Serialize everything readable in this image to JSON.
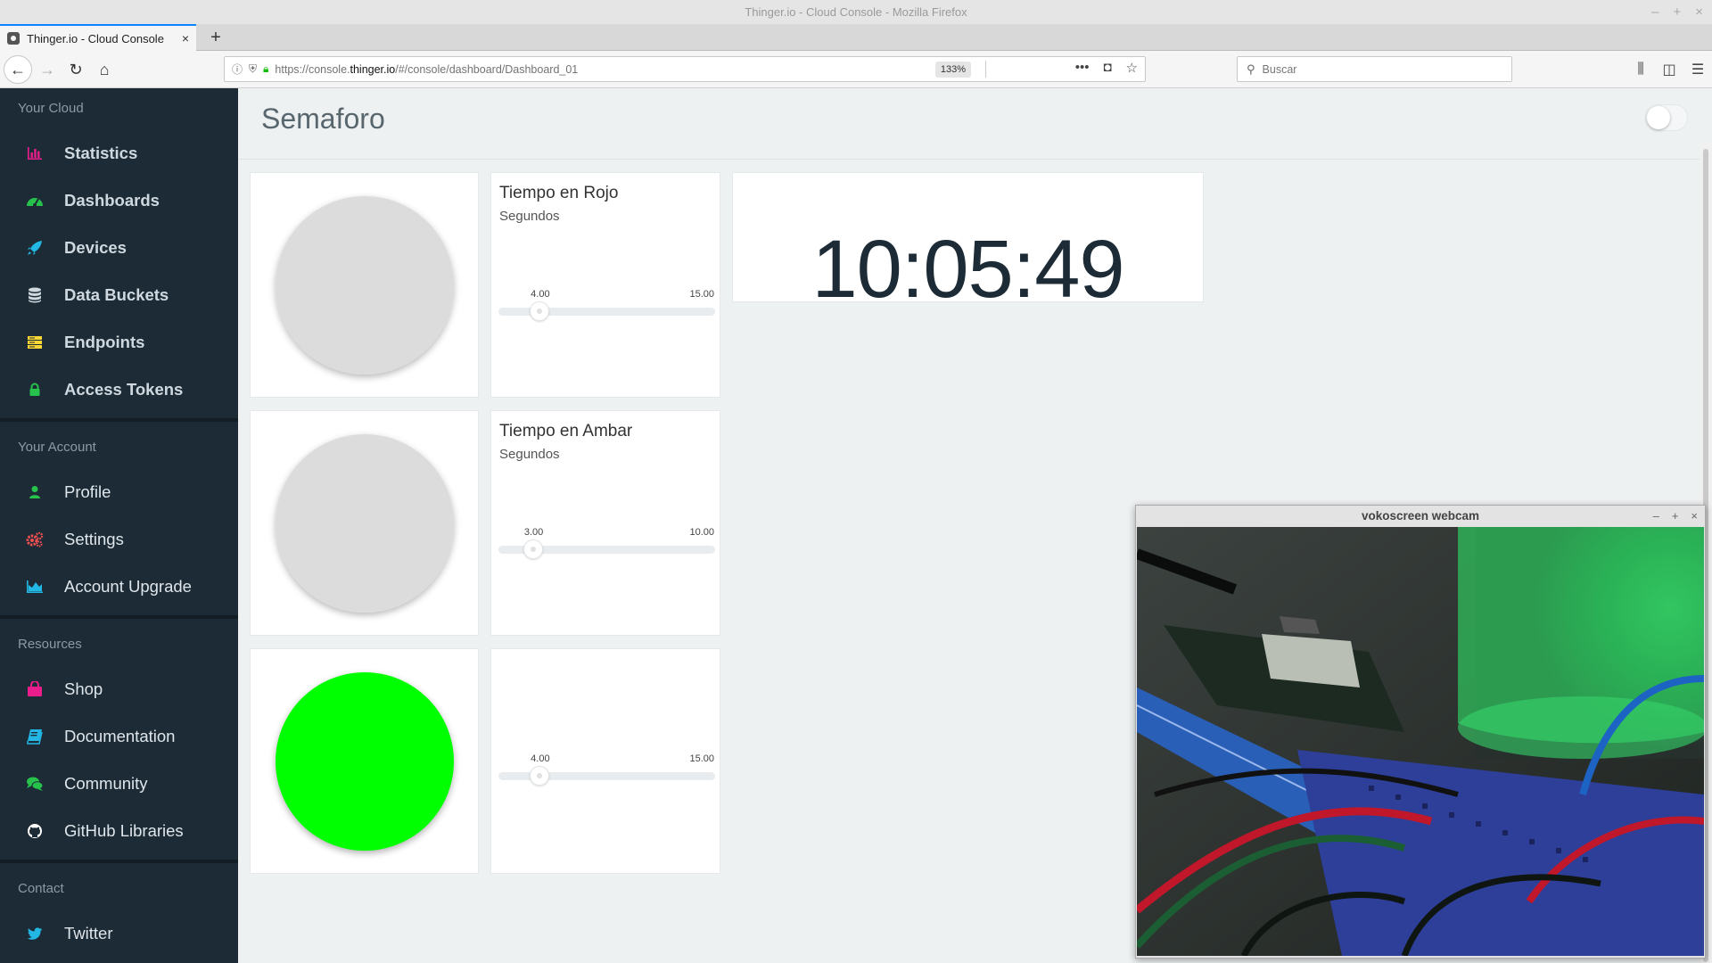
{
  "window": {
    "title": "Thinger.io - Cloud Console - Mozilla Firefox",
    "controls": [
      "–",
      "+",
      "×"
    ]
  },
  "tabs": [
    {
      "title": "Thinger.io - Cloud Console",
      "close": "×"
    }
  ],
  "new_tab": "+",
  "navbar": {
    "back": "←",
    "forward": "→",
    "reload": "↻",
    "home": "⌂",
    "url_prefix": "https://console.",
    "url_host": "thinger.io",
    "url_path": "/#/console/dashboard/Dashboard_01",
    "zoom": "133%",
    "page_actions": [
      "•••",
      "◘",
      "☆"
    ],
    "search_placeholder": "Buscar",
    "tool_icons": [
      "library-icon",
      "sidebar-toggle-icon",
      "menu-icon"
    ]
  },
  "sidebar": {
    "sections": [
      {
        "title": "Your Cloud",
        "items": [
          {
            "label": "Statistics",
            "icon": "bar-chart-icon",
            "color": "#e91e8c"
          },
          {
            "label": "Dashboards",
            "icon": "dashboard-icon",
            "color": "#27c24c"
          },
          {
            "label": "Devices",
            "icon": "rocket-icon",
            "color": "#23b7e5"
          },
          {
            "label": "Data Buckets",
            "icon": "database-icon",
            "color": "#cfd8df"
          },
          {
            "label": "Endpoints",
            "icon": "server-icon",
            "color": "#fad733"
          },
          {
            "label": "Access Tokens",
            "icon": "lock-icon",
            "color": "#27c24c"
          }
        ]
      },
      {
        "title": "Your Account",
        "items": [
          {
            "label": "Profile",
            "icon": "user-icon",
            "color": "#27c24c"
          },
          {
            "label": "Settings",
            "icon": "cogs-icon",
            "color": "#f05050"
          },
          {
            "label": "Account Upgrade",
            "icon": "area-chart-icon",
            "color": "#23b7e5"
          }
        ]
      },
      {
        "title": "Resources",
        "items": [
          {
            "label": "Shop",
            "icon": "shopping-bag-icon",
            "color": "#e91e8c"
          },
          {
            "label": "Documentation",
            "icon": "book-icon",
            "color": "#23b7e5"
          },
          {
            "label": "Community",
            "icon": "comments-icon",
            "color": "#27c24c"
          },
          {
            "label": "GitHub Libraries",
            "icon": "github-icon",
            "color": "#ffffff"
          }
        ]
      },
      {
        "title": "Contact",
        "items": [
          {
            "label": "Twitter",
            "icon": "twitter-icon",
            "color": "#23b7e5"
          }
        ]
      }
    ]
  },
  "dashboard": {
    "title": "Semaforo",
    "edit_mode": false,
    "leds": [
      {
        "state": "off",
        "color": "#dcdcdc"
      },
      {
        "state": "off",
        "color": "#dcdcdc"
      },
      {
        "state": "on",
        "color": "#00ff00"
      }
    ],
    "sliders": [
      {
        "title": "Tiempo en Rojo",
        "subtitle": "Segundos",
        "value": "4.00",
        "max": "15.00",
        "fraction": 0.19
      },
      {
        "title": "Tiempo en Ambar",
        "subtitle": "Segundos",
        "value": "3.00",
        "max": "10.00",
        "fraction": 0.16
      },
      {
        "title": "",
        "subtitle": "",
        "value": "4.00",
        "max": "15.00",
        "fraction": 0.19
      }
    ],
    "clock": "10:05:49"
  },
  "webcam": {
    "title": "vokoscreen webcam",
    "controls": [
      "–",
      "+",
      "×"
    ]
  }
}
